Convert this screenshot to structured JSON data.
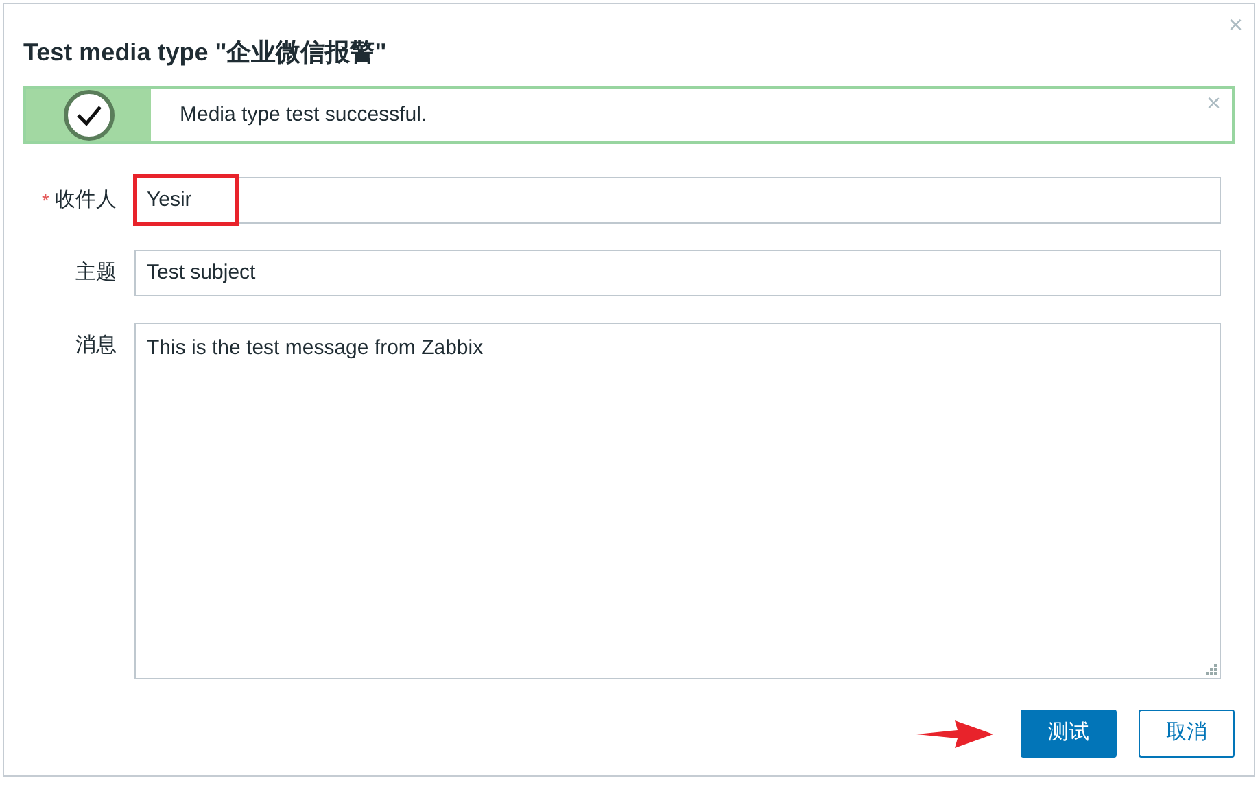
{
  "dialog": {
    "title": "Test media type \"企业微信报警\"",
    "close_symbol": "×"
  },
  "message": {
    "kind": "success",
    "text": "Media type test successful.",
    "close_symbol": "×"
  },
  "fields": [
    {
      "kind": "input",
      "label": "收件人",
      "required_mark": "*",
      "value": "Yesir",
      "highlighted": true
    },
    {
      "kind": "input",
      "label": "主题",
      "value": "Test subject",
      "highlighted": false
    },
    {
      "kind": "textarea",
      "label": "消息",
      "value": "This is the test message from Zabbix",
      "highlighted": false
    }
  ],
  "buttons": [
    {
      "label": "测试",
      "primary": true,
      "pointed": true
    },
    {
      "label": "取消",
      "primary": false,
      "pointed": false
    }
  ]
}
